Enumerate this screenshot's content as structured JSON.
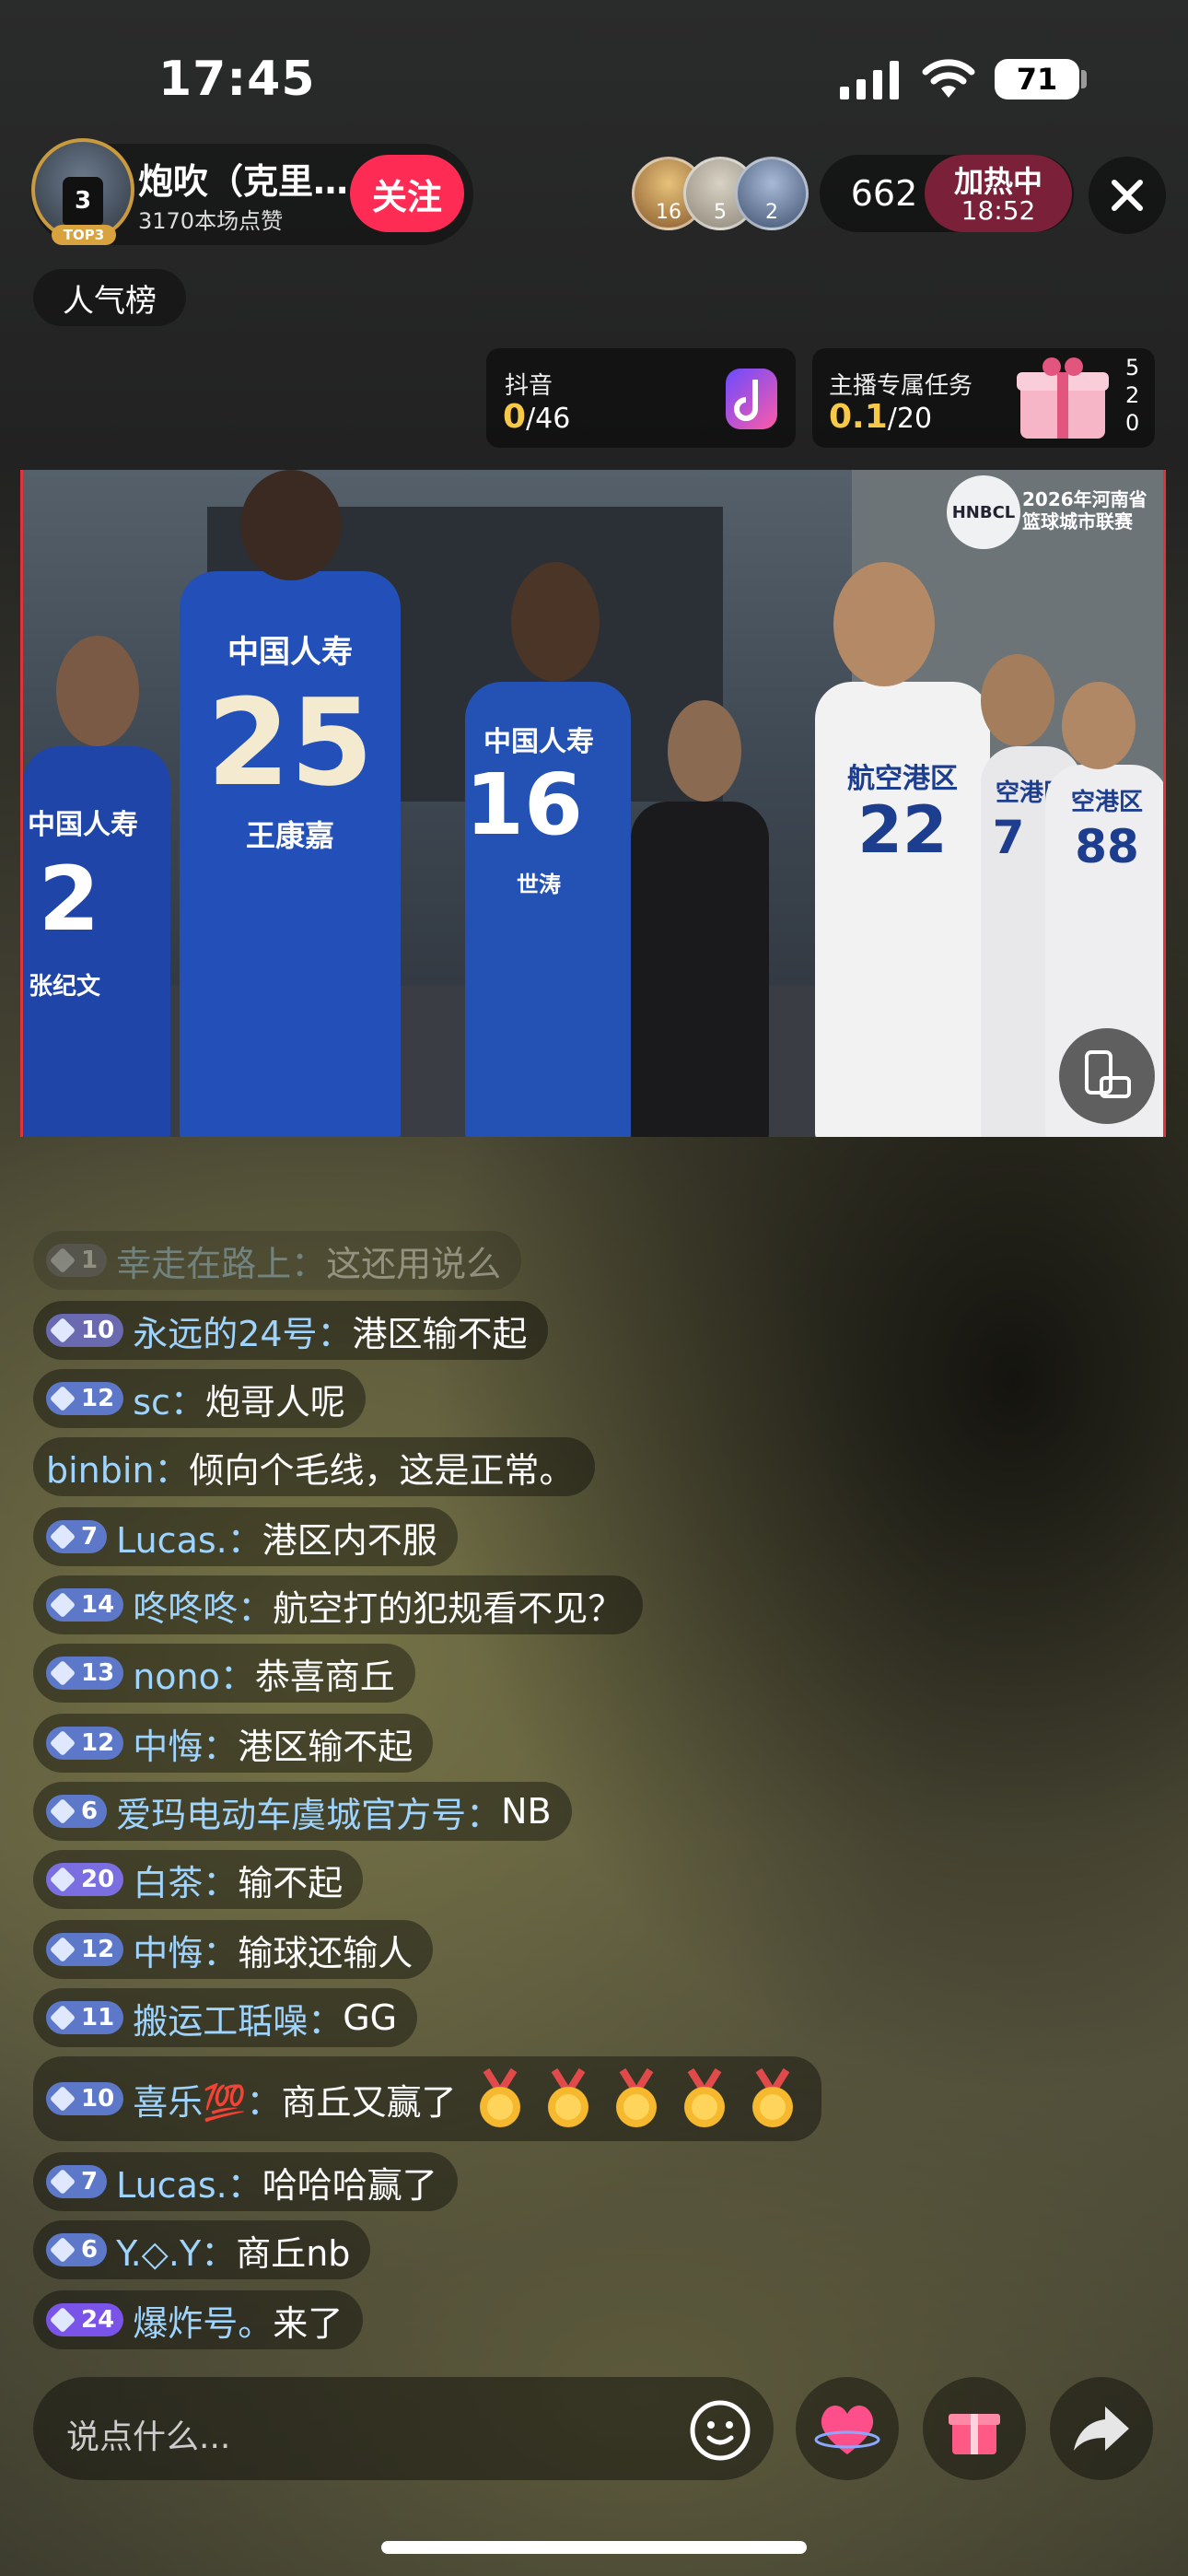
{
  "status_bar": {
    "time": "17:45",
    "battery": "71"
  },
  "host": {
    "name": "炮吹（克里…",
    "likes": "3170本场点赞",
    "rank_badge": "TOP3",
    "avatar_jersey": "3",
    "follow_label": "关注"
  },
  "viewers": [
    {
      "badge": "16"
    },
    {
      "badge": "5"
    },
    {
      "badge": "2"
    }
  ],
  "audience_count": "662",
  "heat": {
    "label": "加热中",
    "time": "18:52"
  },
  "popularity_label": "人气榜",
  "tasks": {
    "douyin": {
      "title": "抖音",
      "current": "0",
      "total": "/46"
    },
    "anchor": {
      "title": "主播专属任务",
      "current": "0.1",
      "total": "/20",
      "side": [
        "5",
        "2",
        "0"
      ]
    }
  },
  "video": {
    "league_logo": "HNBCL",
    "league_name_line1": "2026年河南省",
    "league_name_line2": "篮球城市联赛",
    "players": {
      "p1": {
        "team": "中国人寿",
        "number": "25",
        "name": "王康嘉"
      },
      "p2": {
        "team": "中国人寿",
        "number": "2",
        "name": "张纪文"
      },
      "p3": {
        "team": "中国人寿",
        "number": "16",
        "name": "世涛"
      },
      "p4": {
        "team": "航空港区",
        "number": "22"
      },
      "p5": {
        "team": "空港区",
        "number": "7"
      },
      "p6": {
        "team": "空港区",
        "number": "88"
      }
    }
  },
  "comments": [
    {
      "level": "1",
      "user": "幸走在路上：",
      "text": "这还用说么"
    },
    {
      "level": "10",
      "user": "永远的24号：",
      "text": "港区输不起"
    },
    {
      "level": "12",
      "user": "sc：",
      "text": "炮哥人呢"
    },
    {
      "level": "",
      "user": "binbin：",
      "text": "倾向个毛线，这是正常。"
    },
    {
      "level": "7",
      "user": "Lucas.：",
      "text": "港区内不服"
    },
    {
      "level": "14",
      "user": "咚咚咚：",
      "text": "航空打的犯规看不见？"
    },
    {
      "level": "13",
      "user": "nono：",
      "text": "恭喜商丘"
    },
    {
      "level": "12",
      "user": "中悔：",
      "text": "港区输不起"
    },
    {
      "level": "6",
      "user": "爱玛电动车虞城官方号：",
      "text": "NB"
    },
    {
      "level": "20",
      "user": "白茶：",
      "text": "输不起"
    },
    {
      "level": "12",
      "user": "中悔：",
      "text": "输球还输人"
    },
    {
      "level": "11",
      "user": "搬运工聒噪：",
      "text": "GG"
    },
    {
      "level": "10",
      "user": "喜乐💯：",
      "text": "商丘又赢了"
    },
    {
      "level": "7",
      "user": "Lucas.：",
      "text": "哈哈哈赢了"
    },
    {
      "level": "6",
      "user": "Y.◇.Y：",
      "text": "商丘nb"
    },
    {
      "level": "24",
      "user": "爆炸号。",
      "text": "来了"
    }
  ],
  "input": {
    "placeholder": "说点什么..."
  },
  "colors": {
    "accent_follow": "#fe2c55",
    "heat": "#7a2038",
    "username": "#9fd4ff",
    "progress": "#f7c948"
  }
}
